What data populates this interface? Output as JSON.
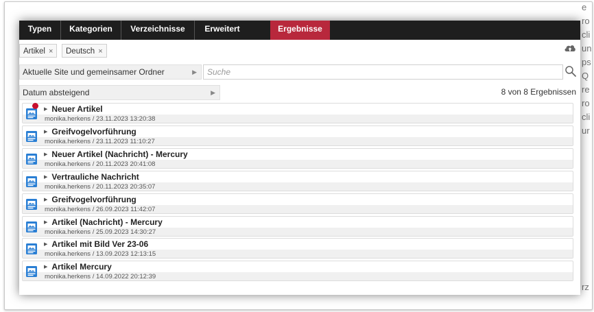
{
  "tabs": [
    {
      "label": "Typen"
    },
    {
      "label": "Kategorien"
    },
    {
      "label": "Verzeichnisse"
    },
    {
      "label": "Erweitert"
    },
    {
      "label": "Ergebnisse"
    }
  ],
  "filters": [
    {
      "label": "Artikel",
      "remove": "×"
    },
    {
      "label": "Deutsch",
      "remove": "×"
    }
  ],
  "scope_select": {
    "value": "Aktuelle Site und gemeinsamer Ordner"
  },
  "search": {
    "placeholder": "Suche"
  },
  "sort_select": {
    "value": "Datum absteigend"
  },
  "result_count": "8 von 8 Ergebnissen",
  "results": [
    {
      "title": "Neuer Artikel",
      "meta": "monika.herkens / 23.11.2023 13:20:38",
      "new": true
    },
    {
      "title": "Greifvogelvorführung",
      "meta": "monika.herkens / 23.11.2023 11:10:27"
    },
    {
      "title": "Neuer Artikel (Nachricht) - Mercury",
      "meta": "monika.herkens / 20.11.2023 20:41:08"
    },
    {
      "title": "Vertrauliche Nachricht",
      "meta": "monika.herkens / 20.11.2023 20:35:07"
    },
    {
      "title": "Greifvogelvorführung",
      "meta": "monika.herkens / 26.09.2023 11:42:07"
    },
    {
      "title": "Artikel (Nachricht) - Mercury",
      "meta": "monika.herkens / 25.09.2023 14:30:27"
    },
    {
      "title": "Artikel mit Bild Ver 23-06",
      "meta": "monika.herkens / 13.09.2023 12:13:15"
    },
    {
      "title": "Artikel Mercury",
      "meta": "monika.herkens / 14.09.2022 20:12:39"
    }
  ],
  "background_text": [
    "e",
    "ro",
    "cli",
    "un",
    "ps",
    "Q",
    "re",
    "ro",
    "cli",
    "ur",
    "rz"
  ],
  "colors": {
    "tab_active": "#b8283c",
    "tabbar": "#1e1e1e",
    "new_dot": "#c8102e",
    "file_icon": "#2a7fd4"
  },
  "icons": {
    "upload": "cloud-upload-icon",
    "search": "magnifier-icon",
    "row": "article-file-icon"
  }
}
